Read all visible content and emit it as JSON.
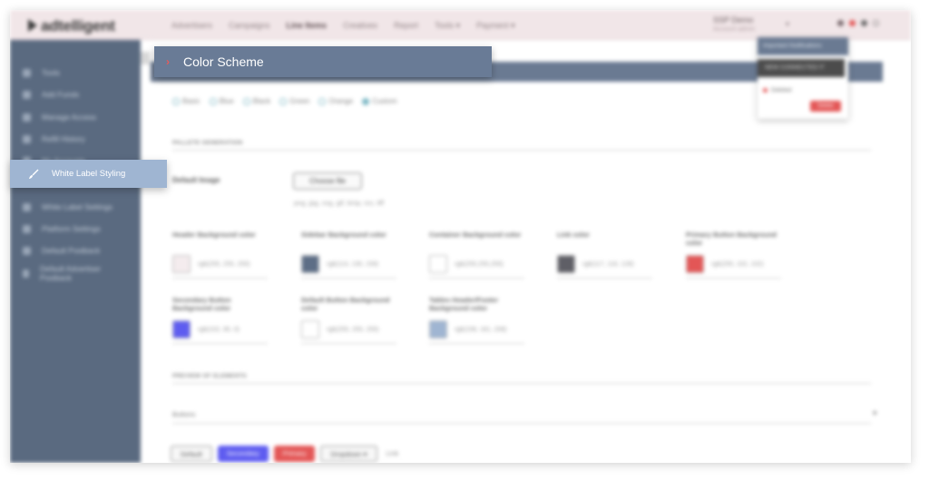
{
  "app": {
    "logo": "adtelligent"
  },
  "topbar": {
    "nav": [
      "Advertisers",
      "Campaigns",
      "Line Items",
      "Creatives",
      "Report",
      "Tools ▾",
      "Payment ▾"
    ],
    "active_nav": "Line Items",
    "account_name": "SSP Demo",
    "account_sub": "Account admin",
    "account_caret": "▾"
  },
  "sidebar": {
    "items": [
      {
        "label": "Tools",
        "icon": "user-icon"
      },
      {
        "label": "Add Funds",
        "icon": "wallet-icon"
      },
      {
        "label": "Manage Access",
        "icon": "key-icon"
      },
      {
        "label": "Refill History",
        "icon": "history-icon"
      },
      {
        "label": "My Accounts",
        "icon": "users-icon"
      },
      {
        "label": "White Label Styling",
        "icon": "paint-brush-icon"
      },
      {
        "label": "White Label Settings",
        "icon": "pencil-icon"
      },
      {
        "label": "Platform Settings",
        "icon": "gear-icon"
      },
      {
        "label": "Default Postback",
        "icon": "link-icon"
      },
      {
        "label": "Default Advertiser Postback",
        "icon": "link-icon"
      }
    ]
  },
  "color_scheme": {
    "title": "Color Scheme",
    "options": [
      {
        "label": "Basic",
        "selected": false
      },
      {
        "label": "Blue",
        "selected": false
      },
      {
        "label": "Black",
        "selected": false
      },
      {
        "label": "Green",
        "selected": false
      },
      {
        "label": "Orange",
        "selected": false
      },
      {
        "label": "Custom",
        "selected": true
      }
    ]
  },
  "palette": {
    "section_title": "PALLETE GENERATION",
    "default_image_label": "Default Image",
    "choose_file_label": "Choose file",
    "file_types": "png, jpg, svg, gif, bmp, ico, tiff",
    "fields": [
      {
        "label": "Header Background color",
        "value": "rgb(255, 255, 255)",
        "swatch": "#f4ecee"
      },
      {
        "label": "Sidebar Background color",
        "value": "rgb(114, 130, 159)",
        "swatch": "#5d6e86"
      },
      {
        "label": "Container Background color",
        "value": "rgb(255,255,255)",
        "swatch": "#ffffff"
      },
      {
        "label": "Link color",
        "value": "rgb(117, 116, 128)",
        "swatch": "#5f5f66"
      },
      {
        "label": "Primary Button Background color",
        "value": "rgb(255, 102, 102)",
        "swatch": "#e35656"
      },
      {
        "label": "Secondary Button Background color",
        "value": "rgb(102, 90, 0)",
        "swatch": "#5e5cf0"
      },
      {
        "label": "Default Button Background color",
        "value": "rgb(255, 255, 255)",
        "swatch": "#ffffff"
      },
      {
        "label": "Tables Header/Footer Background color",
        "value": "rgb(158, 181, 208)",
        "swatch": "#9fb5d2"
      }
    ]
  },
  "preview": {
    "section_title": "PREVIEW OF ELEMENTS",
    "accordion_label": "Buttons",
    "accordion_chevron": "▾",
    "buttons": {
      "default": "Default",
      "secondary": "Secondary",
      "primary": "Primary",
      "dropdown": "Dropdown ▾",
      "link": "Link"
    }
  },
  "notification": {
    "header": "Important Notifications",
    "item": "NEW CONNECTED IT",
    "sub": "Deleted",
    "button": "Delete"
  },
  "highlight": {
    "header_chevron": "›",
    "header_title": "Color Scheme",
    "menu_label": "White Label Styling"
  },
  "colors": {
    "sidebar": "#5a6a80",
    "header_bar": "#697b96",
    "menu_highlight": "#9fb5d2",
    "accent_red": "#e35656"
  }
}
